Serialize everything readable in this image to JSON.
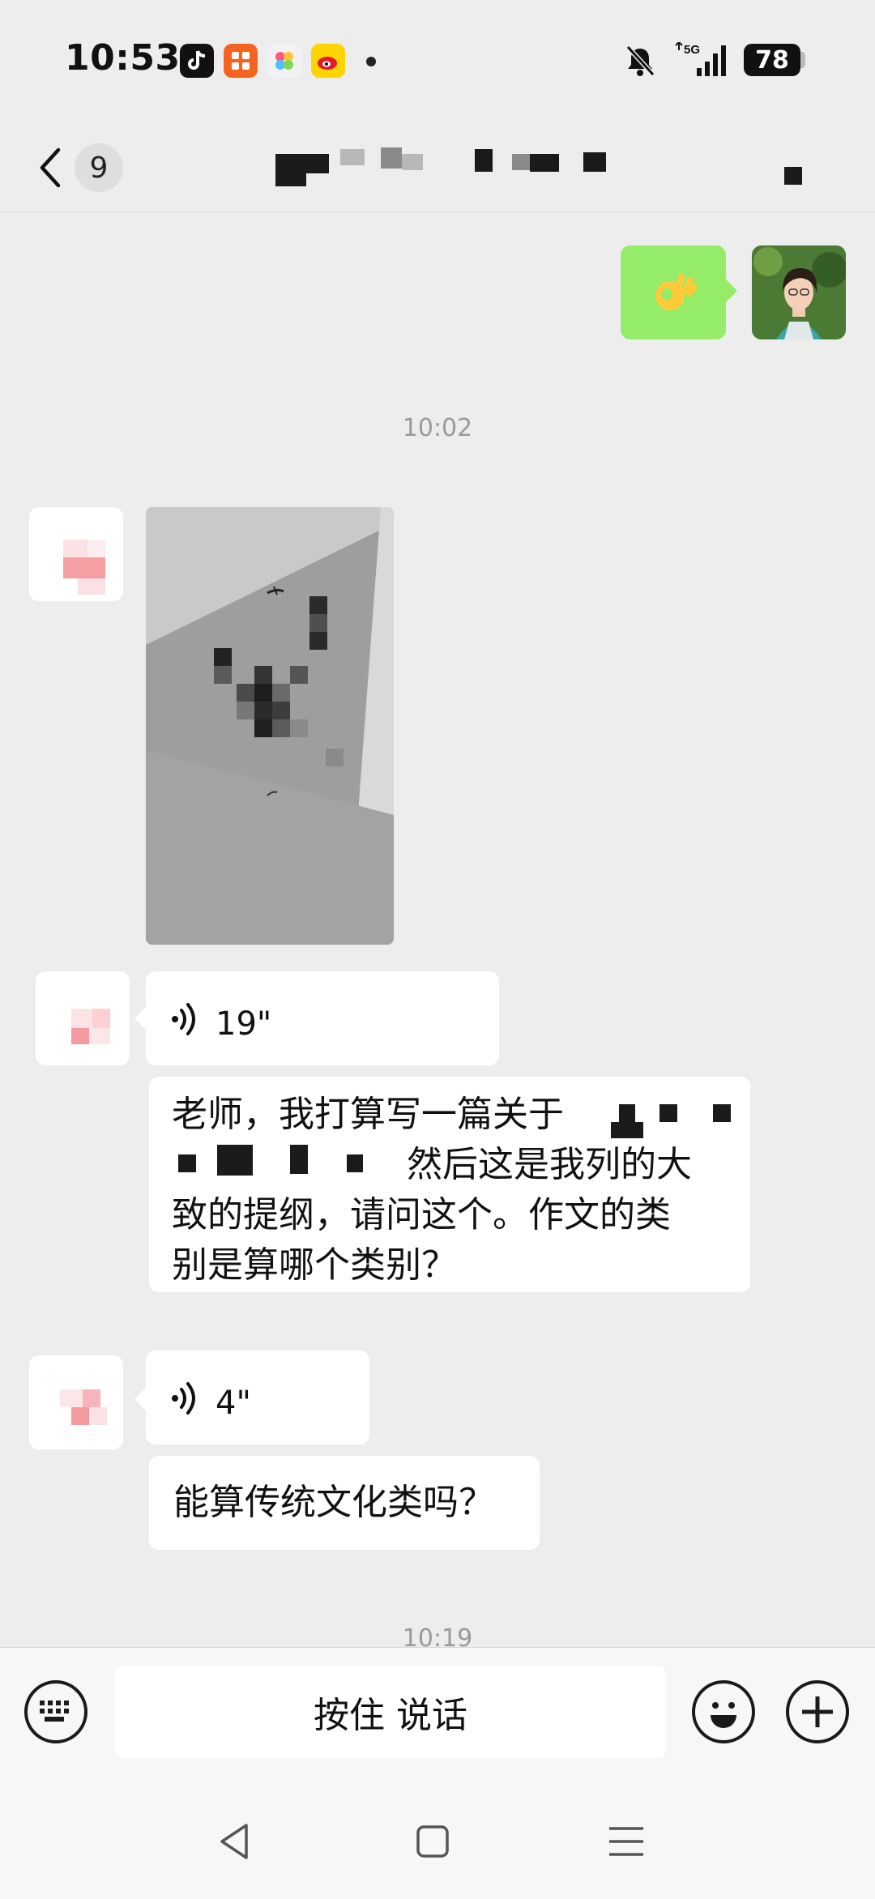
{
  "status_bar": {
    "time": "10:53",
    "network": "5G",
    "battery": "78",
    "icons": [
      "tiktok-icon",
      "app-grid-icon",
      "colorful-app-icon",
      "weibo-icon",
      "notification-dot-icon",
      "mute-bell-icon",
      "signal-icon",
      "battery-icon"
    ]
  },
  "nav": {
    "unread_count": "9",
    "back_icon": "chevron-left-icon"
  },
  "messages": [
    {
      "type": "timestamp",
      "text": "10:02"
    },
    {
      "type": "voice",
      "sender": "other",
      "duration": "19\""
    },
    {
      "type": "text",
      "sender": "other",
      "lines": [
        "老师，我打算写一篇关于",
        "然后这是我列的大",
        "致的提纲，请问这个。作文的类",
        "别是算哪个类别？"
      ]
    },
    {
      "type": "voice",
      "sender": "other",
      "duration": "4\""
    },
    {
      "type": "text",
      "sender": "other",
      "text": "能算传统文化类吗？"
    },
    {
      "type": "timestamp",
      "text": "10:19"
    }
  ],
  "input_bar": {
    "hold_to_talk": "按住 说话",
    "icons": [
      "keyboard-icon",
      "emoji-icon",
      "plus-icon"
    ]
  },
  "colors": {
    "background": "#EDEDED",
    "sent_bubble": "#95EC69",
    "received_bubble": "#FFFFFF",
    "timestamp": "#9A9A9A"
  }
}
